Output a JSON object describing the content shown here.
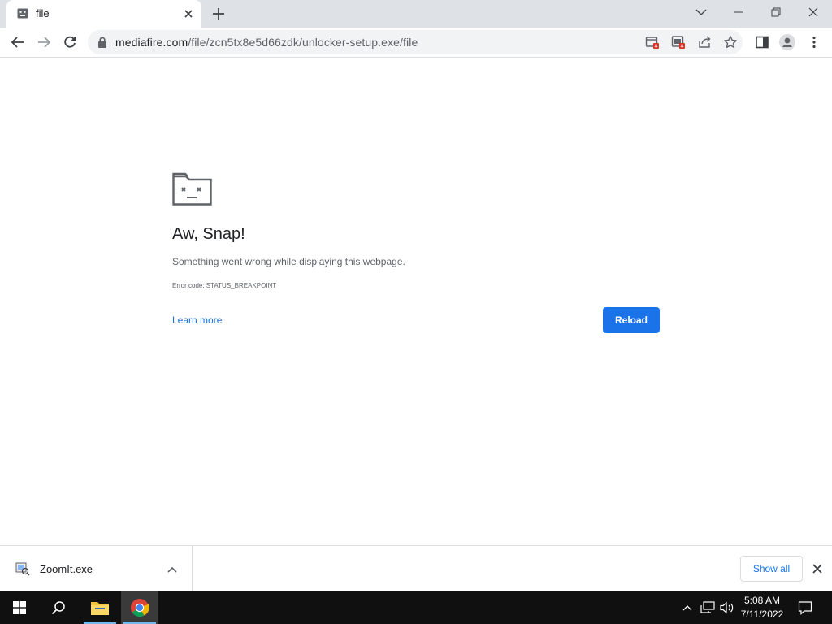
{
  "tab": {
    "title": "file",
    "new_tab_label": "+"
  },
  "omnibox": {
    "url_host": "mediafire.com",
    "url_path": "/file/zcn5tx8e5d66zdk/unlocker-setup.exe/file"
  },
  "error_page": {
    "title": "Aw, Snap!",
    "message": "Something went wrong while displaying this webpage.",
    "error_code": "Error code: STATUS_BREAKPOINT",
    "learn_more": "Learn more",
    "reload": "Reload"
  },
  "downloads": {
    "item_name": "ZoomIt.exe",
    "show_all": "Show all"
  },
  "taskbar": {
    "time": "5:08 AM",
    "date": "7/11/2022"
  },
  "colors": {
    "accent": "#1a73e8",
    "tabstrip": "#dee1e6",
    "taskbar": "#101010"
  },
  "icons": {
    "tab_favicon": "sad-tab-icon",
    "back": "back-arrow-icon",
    "forward": "forward-arrow-icon",
    "reload": "reload-icon",
    "lock": "lock-icon",
    "bookmark": "star-icon",
    "profile": "avatar-icon",
    "menu": "kebab-menu-icon",
    "start": "windows-logo-icon",
    "search": "search-icon",
    "explorer": "folder-icon",
    "chrome": "chrome-icon"
  }
}
